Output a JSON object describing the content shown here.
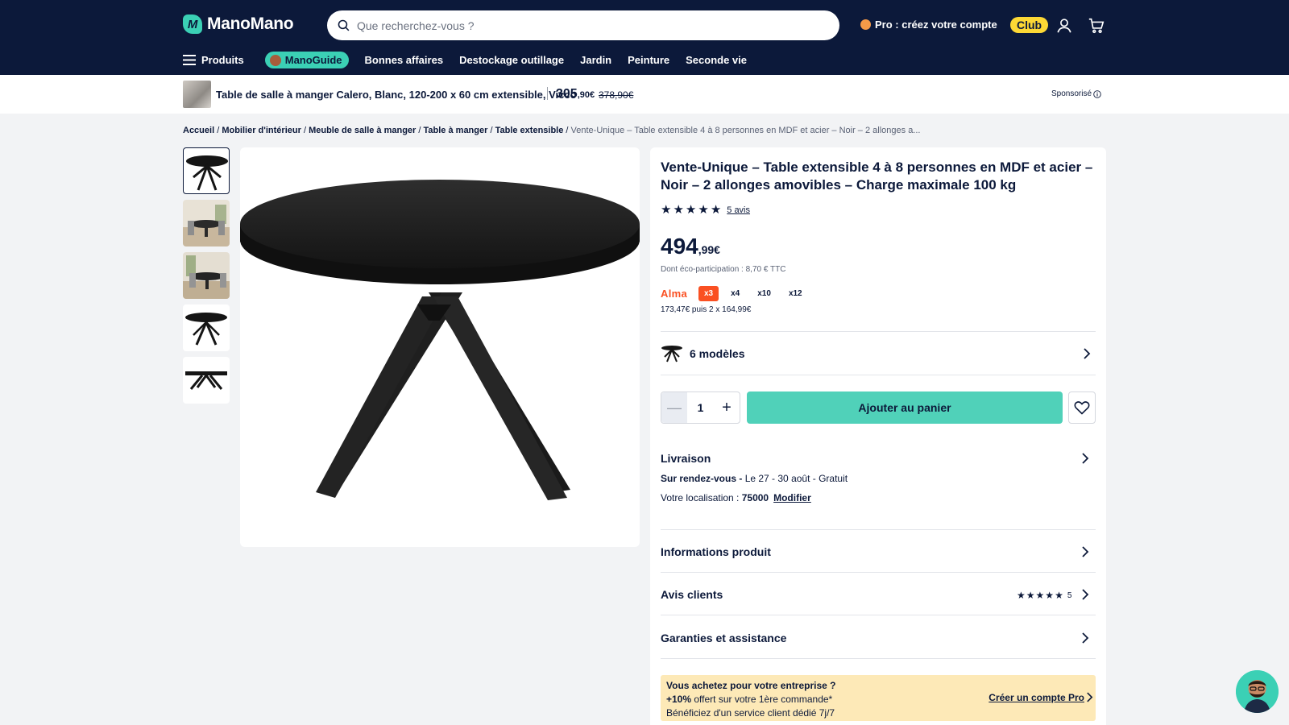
{
  "header": {
    "logo_text": "ManoMano",
    "search_placeholder": "Que recherchez-vous ?",
    "pro_link": "Pro : créez votre compte",
    "club_label": "Club",
    "account_icon": "user-icon",
    "cart_icon": "cart-icon"
  },
  "nav": {
    "products": "Produits",
    "guide": "ManoGuide",
    "items": [
      "Bonnes affaires",
      "Destockage outillage",
      "Jardin",
      "Peinture",
      "Seconde vie"
    ]
  },
  "sponsored": {
    "title": "Table de salle à manger Calero, Blanc, 120-200 x 60 cm extensible, Vicco",
    "price_int": "305",
    "price_dec": ",90€",
    "old_price": "378,90€",
    "label": "Sponsorisé"
  },
  "breadcrumb": {
    "items": [
      "Accueil",
      "Mobilier d'intérieur",
      "Meuble de salle à manger",
      "Table à manger",
      "Table extensible"
    ],
    "current": "Vente-Unique – Table extensible 4 à 8 personnes en MDF et acier – Noir – 2 allonges a..."
  },
  "product": {
    "title": "Vente-Unique – Table extensible 4 à 8 personnes en MDF et acier – Noir – 2 allonges amovibles – Charge maximale 100 kg",
    "rating": 5,
    "reviews_link": "5 avis",
    "price_int": "494",
    "price_dec": ",99€",
    "eco": "Dont éco-participation : 8,70 € TTC",
    "alma": {
      "brand": "Alma",
      "options": [
        "x3",
        "x4",
        "x10",
        "x12"
      ],
      "selected": "x3",
      "detail": "173,47€ puis 2 x 164,99€"
    },
    "models_label": "6 modèles",
    "quantity": "1",
    "add_to_cart": "Ajouter au panier"
  },
  "delivery": {
    "title": "Livraison",
    "mode": "Sur rendez-vous -",
    "dates": " Le 27 - 30 août - Gratuit",
    "location_label": "Votre localisation : ",
    "postcode": "75000",
    "modify": "Modifier"
  },
  "sections": {
    "info": "Informations produit",
    "reviews": "Avis clients",
    "reviews_count": "5",
    "warranty": "Garanties et assistance"
  },
  "pro_box": {
    "line1": "Vous achetez pour votre entreprise ?",
    "line2_bold": "+10%",
    "line2": " offert sur votre 1ère commande*",
    "line3": "Bénéficiez d'un service client dédié 7j/7",
    "cta": "Créer un compte Pro"
  },
  "colors": {
    "header_bg": "#0c193a",
    "accent": "#3bd0b5",
    "cart_button": "#50d1b9",
    "alma": "#fa5022",
    "club": "#fdd835",
    "pro_box": "#fde9b7"
  }
}
